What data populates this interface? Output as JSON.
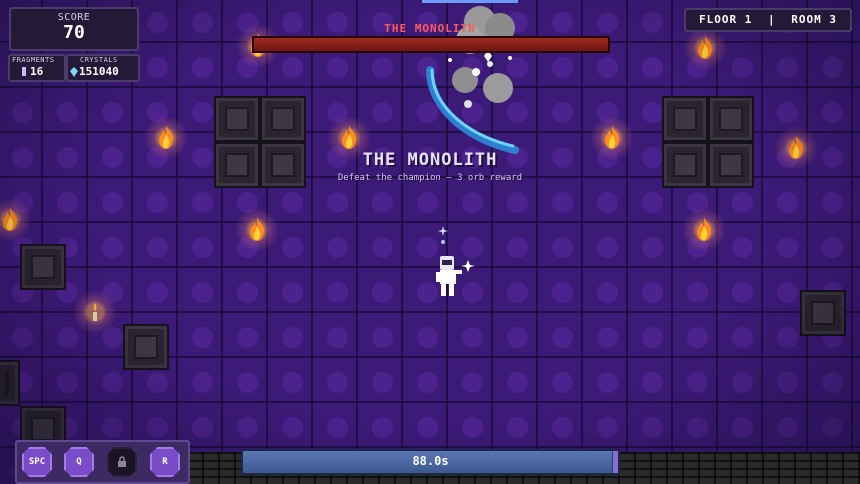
{
  "hud": {
    "score_label": "SCORE",
    "score_value": "70",
    "fragments_label": "FRAGMENTS",
    "fragments_value": "16",
    "crystals_label": "CRYSTALS",
    "crystals_value": "151040",
    "floor_label": "FLOOR 1",
    "separator": "|",
    "room_label": "ROOM 3"
  },
  "boss": {
    "name_bar": "THE MONOLITH",
    "health_fraction": 1.0,
    "title": "THE MONOLITH",
    "subtitle": "Defeat the champion — 3 orb reward"
  },
  "timer": {
    "text": "88.0s",
    "fraction": 0.985
  },
  "skills": [
    {
      "key": "SPC",
      "locked": false
    },
    {
      "key": "Q",
      "locked": false
    },
    {
      "key": "",
      "locked": true,
      "icon": "lock-icon"
    },
    {
      "key": "R",
      "locked": false
    }
  ],
  "colors": {
    "floor": "#3c1a78",
    "boss_name": "#ff5a5a",
    "health_bar": "#a02a22",
    "timer_bar": "#5a77b4",
    "skill_button": "#7b4cc8"
  }
}
